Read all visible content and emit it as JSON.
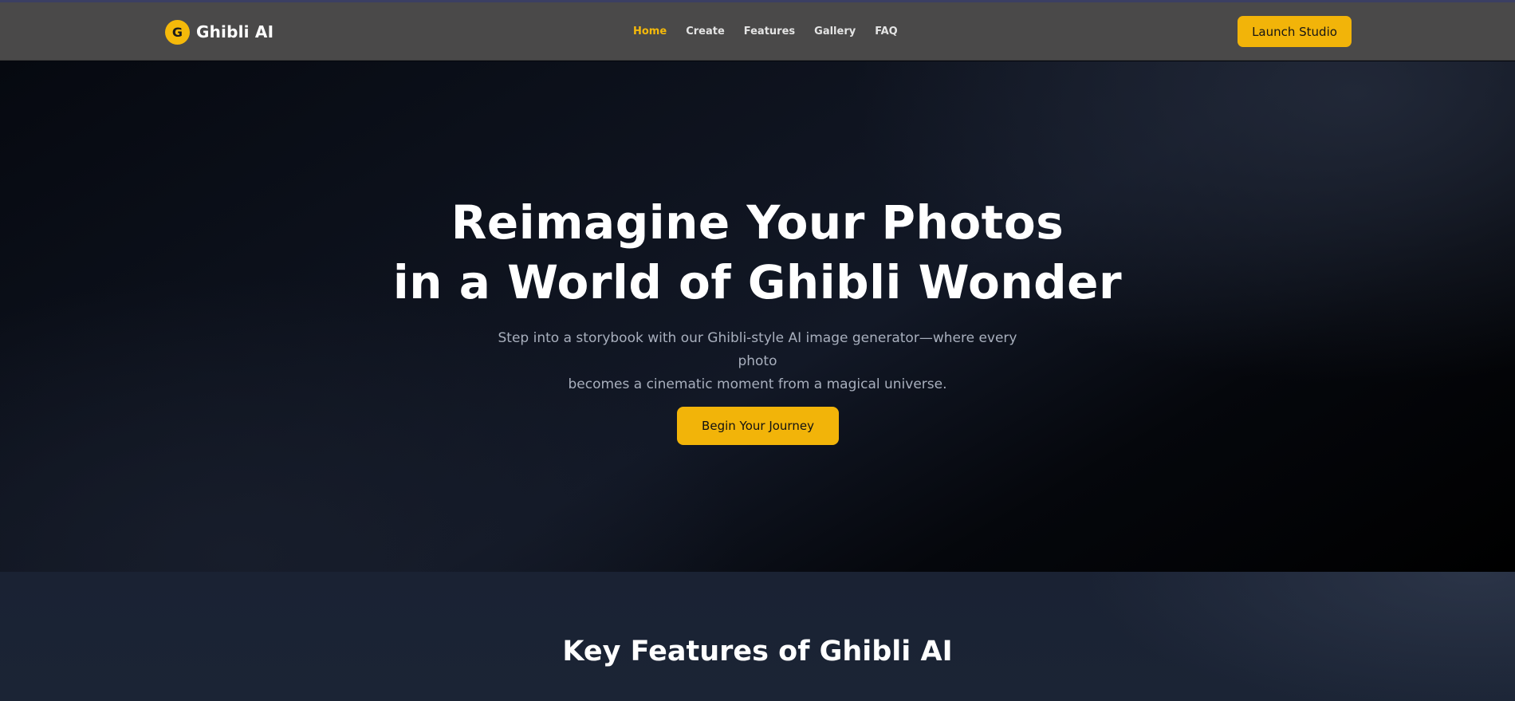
{
  "header": {
    "brand_letter": "G",
    "brand_name": "Ghibli AI",
    "nav": [
      {
        "label": "Home",
        "active": true
      },
      {
        "label": "Create",
        "active": false
      },
      {
        "label": "Features",
        "active": false
      },
      {
        "label": "Gallery",
        "active": false
      },
      {
        "label": "FAQ",
        "active": false
      }
    ],
    "cta_label": "Launch Studio"
  },
  "hero": {
    "title_line1": "Reimagine Your Photos",
    "title_line2": "in a World of Ghibli Wonder",
    "subtitle_line1": "Step into a storybook with our Ghibli-style AI image generator—where every photo",
    "subtitle_line2": "becomes a cinematic moment from a magical universe.",
    "cta_label": "Begin Your Journey"
  },
  "features": {
    "title": "Key Features of Ghibli AI"
  },
  "colors": {
    "accent": "#f2b409",
    "header_bg": "#4a4949",
    "hero_bg": "#0f1420",
    "features_bg": "#1a2233"
  }
}
